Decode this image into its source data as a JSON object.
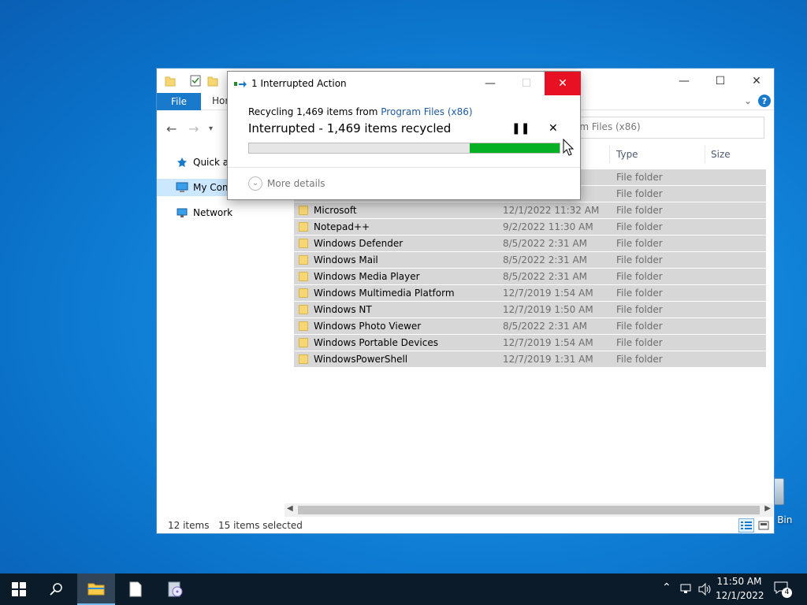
{
  "explorer": {
    "ribbon": {
      "file_tab": "File",
      "home_tab": "Hor"
    },
    "search_placeholder": "am Files (x86)",
    "sidebar": [
      {
        "label": "Quick ac",
        "icon": "star-icon"
      },
      {
        "label": "My Com",
        "icon": "computer-icon",
        "selected": true
      },
      {
        "label": "Network",
        "icon": "network-icon"
      }
    ],
    "columns": {
      "type": "Type",
      "size": "Size"
    },
    "rows": [
      {
        "name": "",
        "date": "",
        "type": "File folder"
      },
      {
        "name": "",
        "date": "",
        "type": "File folder"
      },
      {
        "name": "Microsoft",
        "date": "12/1/2022 11:32 AM",
        "type": "File folder"
      },
      {
        "name": "Notepad++",
        "date": "9/2/2022 11:30 AM",
        "type": "File folder"
      },
      {
        "name": "Windows Defender",
        "date": "8/5/2022 2:31 AM",
        "type": "File folder"
      },
      {
        "name": "Windows Mail",
        "date": "8/5/2022 2:31 AM",
        "type": "File folder"
      },
      {
        "name": "Windows Media Player",
        "date": "8/5/2022 2:31 AM",
        "type": "File folder"
      },
      {
        "name": "Windows Multimedia Platform",
        "date": "12/7/2019 1:54 AM",
        "type": "File folder"
      },
      {
        "name": "Windows NT",
        "date": "12/7/2019 1:50 AM",
        "type": "File folder"
      },
      {
        "name": "Windows Photo Viewer",
        "date": "8/5/2022 2:31 AM",
        "type": "File folder"
      },
      {
        "name": "Windows Portable Devices",
        "date": "12/7/2019 1:54 AM",
        "type": "File folder"
      },
      {
        "name": "WindowsPowerShell",
        "date": "12/7/2019 1:31 AM",
        "type": "File folder"
      }
    ],
    "status": {
      "items": "12 items",
      "selected": "15 items selected"
    }
  },
  "dialog": {
    "title": "1 Interrupted Action",
    "recycling_prefix": "Recycling 1,469 items from ",
    "recycling_link": "Program Files (x86)",
    "status": "Interrupted - 1,469 items recycled",
    "progress_fraction": 0.29,
    "more_details": "More details"
  },
  "desktop": {
    "recycle_bin_label": "e Bin"
  },
  "taskbar": {
    "time": "11:50 AM",
    "date": "12/1/2022",
    "notification_count": "4"
  },
  "colors": {
    "accent": "#1979ca",
    "progress": "#06b025",
    "close": "#e81123"
  }
}
